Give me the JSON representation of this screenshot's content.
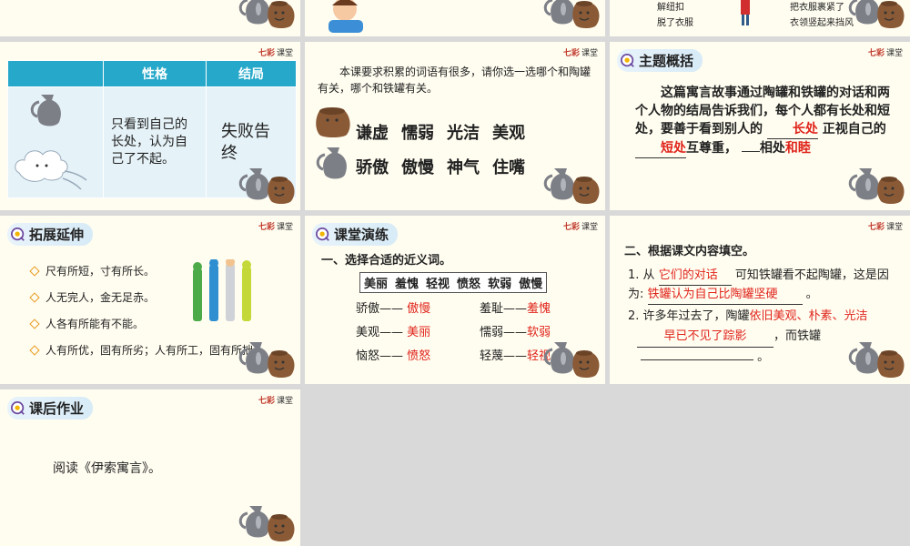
{
  "top_row": {
    "s2_text": [],
    "s3_left": [
      "解纽扣",
      "脱了衣服"
    ],
    "s3_right": [
      "把衣服裹紧了",
      "衣领竖起来挡风"
    ]
  },
  "slide_table": {
    "headers": [
      "性格",
      "结局"
    ],
    "trait": "只看到自己的长处，认为自己了不起。",
    "ending": "失败告终"
  },
  "slide_words": {
    "instruction": "本课要求积累的词语有很多，请你选一选哪个和陶罐有关，哪个和铁罐有关。",
    "row1": [
      "谦虚",
      "懦弱",
      "光洁",
      "美观"
    ],
    "row2": [
      "骄傲",
      "傲慢",
      "神气",
      "住嘴"
    ]
  },
  "slide_theme": {
    "tag": "主题概括",
    "text1": "这篇寓言故事通过陶罐和铁罐的对话和两个人物的结局告诉我们，每个人都有长处和短处，要善于看到别人的",
    "fill1": "长处",
    "text2": "正视自己的",
    "fill2": "短处",
    "text3": "互尊重，",
    "text4": "相处",
    "fill3": "和睦"
  },
  "slide_extend": {
    "tag": "拓展延伸",
    "items": [
      "尺有所短，寸有所长。",
      "人无完人，金无足赤。",
      "人各有所能有不能。",
      "人有所优，固有所劣；人有所工，固有所拙。"
    ]
  },
  "slide_practice": {
    "tag": "课堂演练",
    "question": "一、选择合适的近义词。",
    "bank": [
      "美丽",
      "羞愧",
      "轻视",
      "愤怒",
      "软弱",
      "傲慢"
    ],
    "pairs_left": [
      {
        "word": "骄傲——",
        "answer": "傲慢"
      },
      {
        "word": "美观——",
        "answer": "美丽"
      },
      {
        "word": "恼怒——",
        "answer": "愤怒"
      }
    ],
    "pairs_right": [
      {
        "word": "羞耻——",
        "answer": "羞愧"
      },
      {
        "word": "懦弱——",
        "answer": "软弱"
      },
      {
        "word": "轻蔑——",
        "answer": "轻视"
      }
    ]
  },
  "slide_fill": {
    "question": "二、根据课文内容填空。",
    "q1_pre": "1. 从",
    "q1_ans1": "它们的对话",
    "q1_mid": "可知铁罐看不起陶罐，这是因为:",
    "q1_ans2": "铁罐认为自己比陶罐坚硬",
    "q1_end": "。",
    "q2_pre": "2. 许多年过去了，陶罐",
    "q2_ans1": "依旧美观、朴素、光洁",
    "q2_ans2": "早已不见了踪影",
    "q2_mid": "，而铁罐",
    "q2_end": "。"
  },
  "slide_homework": {
    "tag": "课后作业",
    "text": "阅读《伊索寓言》。"
  },
  "logo": {
    "brand": "七彩",
    "suffix": "课堂"
  },
  "colors": {
    "accent": "#25a8c9",
    "answer_red": "#e0241b",
    "slide_bg": "#fffdf0",
    "gap": "#d9d9d9"
  }
}
